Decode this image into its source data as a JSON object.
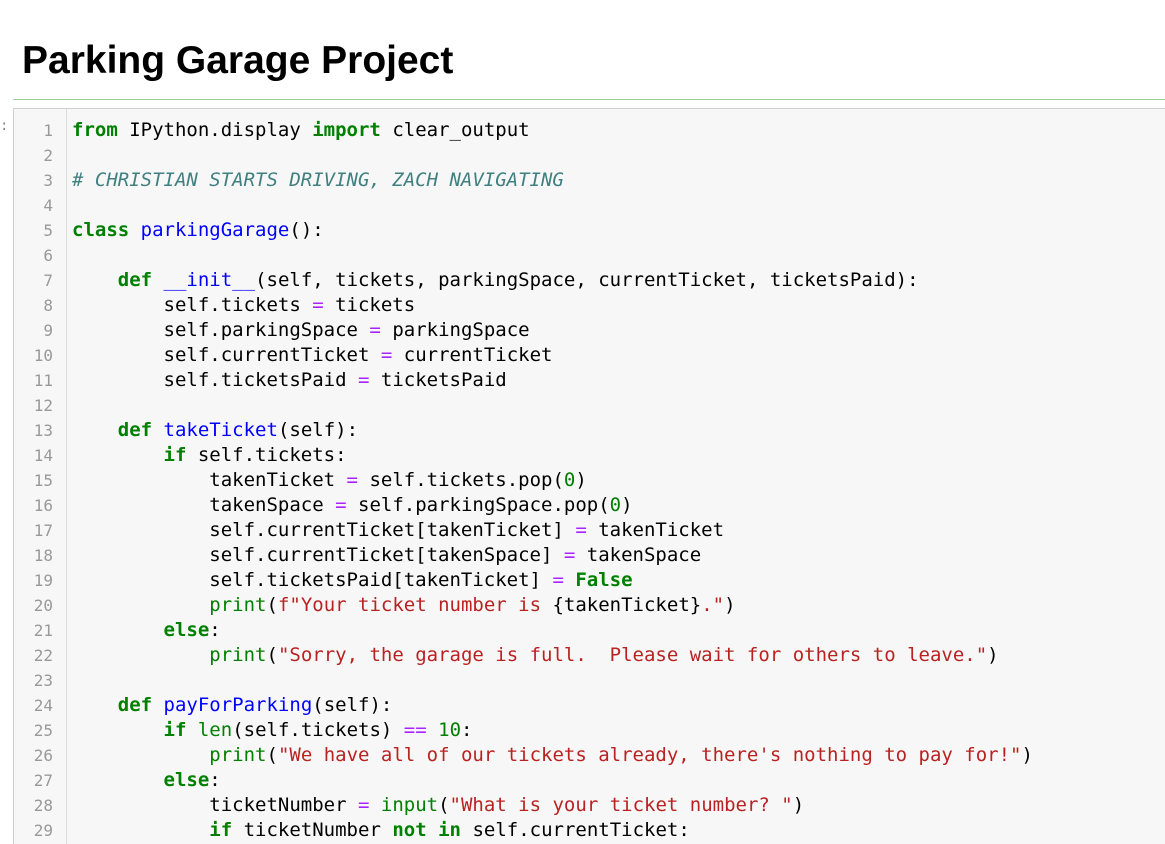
{
  "header": {
    "title": "Parking Garage Project"
  },
  "cell": {
    "prompt": ":",
    "lines": [
      {
        "n": "1",
        "tokens": [
          {
            "t": "kw",
            "v": "from"
          },
          {
            "t": "plain",
            "v": " IPython.display "
          },
          {
            "t": "kw",
            "v": "import"
          },
          {
            "t": "plain",
            "v": " clear_output"
          }
        ]
      },
      {
        "n": "2",
        "tokens": []
      },
      {
        "n": "3",
        "tokens": [
          {
            "t": "com",
            "v": "# CHRISTIAN STARTS DRIVING, ZACH NAVIGATING"
          }
        ]
      },
      {
        "n": "4",
        "tokens": []
      },
      {
        "n": "5",
        "tokens": [
          {
            "t": "kw",
            "v": "class"
          },
          {
            "t": "plain",
            "v": " "
          },
          {
            "t": "def",
            "v": "parkingGarage"
          },
          {
            "t": "plain",
            "v": "():"
          }
        ]
      },
      {
        "n": "6",
        "tokens": []
      },
      {
        "n": "7",
        "tokens": [
          {
            "t": "plain",
            "v": "    "
          },
          {
            "t": "kw",
            "v": "def"
          },
          {
            "t": "plain",
            "v": " "
          },
          {
            "t": "def",
            "v": "__init__"
          },
          {
            "t": "plain",
            "v": "(self, tickets, parkingSpace, currentTicket, ticketsPaid):"
          }
        ]
      },
      {
        "n": "8",
        "tokens": [
          {
            "t": "plain",
            "v": "        self.tickets "
          },
          {
            "t": "op",
            "v": "="
          },
          {
            "t": "plain",
            "v": " tickets"
          }
        ]
      },
      {
        "n": "9",
        "tokens": [
          {
            "t": "plain",
            "v": "        self.parkingSpace "
          },
          {
            "t": "op",
            "v": "="
          },
          {
            "t": "plain",
            "v": " parkingSpace"
          }
        ]
      },
      {
        "n": "10",
        "tokens": [
          {
            "t": "plain",
            "v": "        self.currentTicket "
          },
          {
            "t": "op",
            "v": "="
          },
          {
            "t": "plain",
            "v": " currentTicket"
          }
        ]
      },
      {
        "n": "11",
        "tokens": [
          {
            "t": "plain",
            "v": "        self.ticketsPaid "
          },
          {
            "t": "op",
            "v": "="
          },
          {
            "t": "plain",
            "v": " ticketsPaid"
          }
        ]
      },
      {
        "n": "12",
        "tokens": []
      },
      {
        "n": "13",
        "tokens": [
          {
            "t": "plain",
            "v": "    "
          },
          {
            "t": "kw",
            "v": "def"
          },
          {
            "t": "plain",
            "v": " "
          },
          {
            "t": "def",
            "v": "takeTicket"
          },
          {
            "t": "plain",
            "v": "(self):"
          }
        ]
      },
      {
        "n": "14",
        "tokens": [
          {
            "t": "plain",
            "v": "        "
          },
          {
            "t": "kw",
            "v": "if"
          },
          {
            "t": "plain",
            "v": " self.tickets:"
          }
        ]
      },
      {
        "n": "15",
        "tokens": [
          {
            "t": "plain",
            "v": "            takenTicket "
          },
          {
            "t": "op",
            "v": "="
          },
          {
            "t": "plain",
            "v": " self.tickets.pop("
          },
          {
            "t": "num",
            "v": "0"
          },
          {
            "t": "plain",
            "v": ")"
          }
        ]
      },
      {
        "n": "16",
        "tokens": [
          {
            "t": "plain",
            "v": "            takenSpace "
          },
          {
            "t": "op",
            "v": "="
          },
          {
            "t": "plain",
            "v": " self.parkingSpace.pop("
          },
          {
            "t": "num",
            "v": "0"
          },
          {
            "t": "plain",
            "v": ")"
          }
        ]
      },
      {
        "n": "17",
        "tokens": [
          {
            "t": "plain",
            "v": "            self.currentTicket[takenTicket] "
          },
          {
            "t": "op",
            "v": "="
          },
          {
            "t": "plain",
            "v": " takenTicket"
          }
        ]
      },
      {
        "n": "18",
        "tokens": [
          {
            "t": "plain",
            "v": "            self.currentTicket[takenSpace] "
          },
          {
            "t": "op",
            "v": "="
          },
          {
            "t": "plain",
            "v": " takenSpace"
          }
        ]
      },
      {
        "n": "19",
        "tokens": [
          {
            "t": "plain",
            "v": "            self.ticketsPaid[takenTicket] "
          },
          {
            "t": "op",
            "v": "="
          },
          {
            "t": "plain",
            "v": " "
          },
          {
            "t": "kw",
            "v": "False"
          }
        ]
      },
      {
        "n": "20",
        "tokens": [
          {
            "t": "plain",
            "v": "            "
          },
          {
            "t": "bi",
            "v": "print"
          },
          {
            "t": "plain",
            "v": "("
          },
          {
            "t": "str",
            "v": "f\"Your ticket number is "
          },
          {
            "t": "plain",
            "v": "{takenTicket}"
          },
          {
            "t": "str",
            "v": ".\""
          },
          {
            "t": "plain",
            "v": ")"
          }
        ]
      },
      {
        "n": "21",
        "tokens": [
          {
            "t": "plain",
            "v": "        "
          },
          {
            "t": "kw",
            "v": "else"
          },
          {
            "t": "plain",
            "v": ":"
          }
        ]
      },
      {
        "n": "22",
        "tokens": [
          {
            "t": "plain",
            "v": "            "
          },
          {
            "t": "bi",
            "v": "print"
          },
          {
            "t": "plain",
            "v": "("
          },
          {
            "t": "str",
            "v": "\"Sorry, the garage is full.  Please wait for others to leave.\""
          },
          {
            "t": "plain",
            "v": ")"
          }
        ]
      },
      {
        "n": "23",
        "tokens": []
      },
      {
        "n": "24",
        "tokens": [
          {
            "t": "plain",
            "v": "    "
          },
          {
            "t": "kw",
            "v": "def"
          },
          {
            "t": "plain",
            "v": " "
          },
          {
            "t": "def",
            "v": "payForParking"
          },
          {
            "t": "plain",
            "v": "(self):"
          }
        ]
      },
      {
        "n": "25",
        "tokens": [
          {
            "t": "plain",
            "v": "        "
          },
          {
            "t": "kw",
            "v": "if"
          },
          {
            "t": "plain",
            "v": " "
          },
          {
            "t": "bi",
            "v": "len"
          },
          {
            "t": "plain",
            "v": "(self.tickets) "
          },
          {
            "t": "op",
            "v": "=="
          },
          {
            "t": "plain",
            "v": " "
          },
          {
            "t": "num",
            "v": "10"
          },
          {
            "t": "plain",
            "v": ":"
          }
        ]
      },
      {
        "n": "26",
        "tokens": [
          {
            "t": "plain",
            "v": "            "
          },
          {
            "t": "bi",
            "v": "print"
          },
          {
            "t": "plain",
            "v": "("
          },
          {
            "t": "str",
            "v": "\"We have all of our tickets already, there's nothing to pay for!\""
          },
          {
            "t": "plain",
            "v": ")"
          }
        ]
      },
      {
        "n": "27",
        "tokens": [
          {
            "t": "plain",
            "v": "        "
          },
          {
            "t": "kw",
            "v": "else"
          },
          {
            "t": "plain",
            "v": ":"
          }
        ]
      },
      {
        "n": "28",
        "tokens": [
          {
            "t": "plain",
            "v": "            ticketNumber "
          },
          {
            "t": "op",
            "v": "="
          },
          {
            "t": "plain",
            "v": " "
          },
          {
            "t": "bi",
            "v": "input"
          },
          {
            "t": "plain",
            "v": "("
          },
          {
            "t": "str",
            "v": "\"What is your ticket number? \""
          },
          {
            "t": "plain",
            "v": ")"
          }
        ]
      },
      {
        "n": "29",
        "tokens": [
          {
            "t": "plain",
            "v": "            "
          },
          {
            "t": "kw",
            "v": "if"
          },
          {
            "t": "plain",
            "v": " ticketNumber "
          },
          {
            "t": "kw",
            "v": "not"
          },
          {
            "t": "plain",
            "v": " "
          },
          {
            "t": "kw",
            "v": "in"
          },
          {
            "t": "plain",
            "v": " self.currentTicket:"
          }
        ]
      }
    ]
  }
}
